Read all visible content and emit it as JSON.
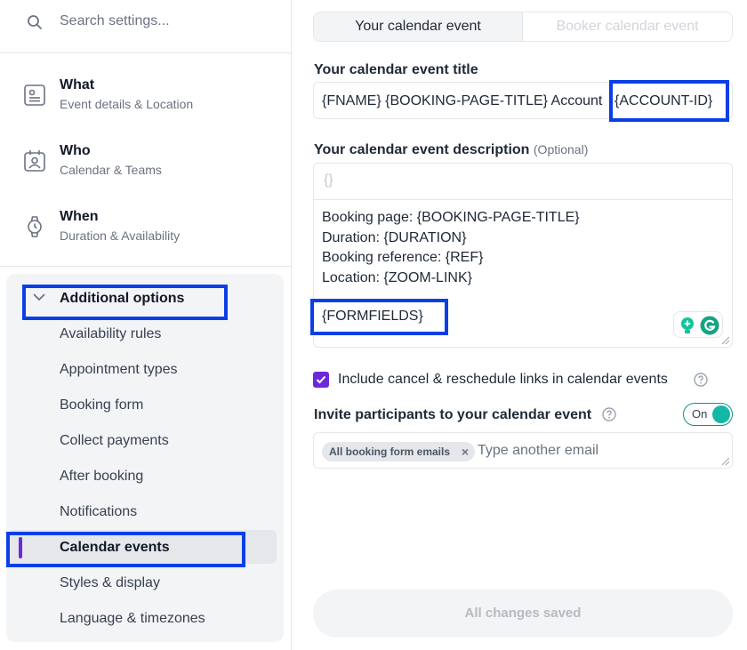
{
  "search": {
    "placeholder": "Search settings..."
  },
  "nav": [
    {
      "title": "What",
      "subtitle": "Event details & Location",
      "icon": "event-details-icon"
    },
    {
      "title": "Who",
      "subtitle": "Calendar & Teams",
      "icon": "calendar-team-icon"
    },
    {
      "title": "When",
      "subtitle": "Duration & Availability",
      "icon": "watch-icon"
    }
  ],
  "additional": {
    "title": "Additional options",
    "items": [
      {
        "label": "Availability rules"
      },
      {
        "label": "Appointment types"
      },
      {
        "label": "Booking form"
      },
      {
        "label": "Collect payments"
      },
      {
        "label": "After booking"
      },
      {
        "label": "Notifications"
      },
      {
        "label": "Calendar events",
        "active": true
      },
      {
        "label": "Styles & display"
      },
      {
        "label": "Language & timezones"
      }
    ]
  },
  "tabs": {
    "active": "Your calendar event",
    "inactive": "Booker calendar event"
  },
  "title_field": {
    "label": "Your calendar event title",
    "value": "{FNAME} {BOOKING-PAGE-TITLE} Account",
    "value_tail": "{ACCOUNT-ID}"
  },
  "description": {
    "label": "Your calendar event description",
    "optional": "(Optional)",
    "insert_symbol": "{}",
    "lines": [
      "Booking page: {BOOKING-PAGE-TITLE}",
      "Duration: {DURATION}",
      "Booking reference: {REF}",
      "Location: {ZOOM-LINK}",
      "{FORMFIELDS}"
    ]
  },
  "include_links": {
    "label": "Include cancel & reschedule links in calendar events",
    "checked": true
  },
  "invite": {
    "label": "Invite participants to your calendar event",
    "toggle": "On"
  },
  "emails": {
    "chip": "All booking form emails",
    "chip_remove": "×",
    "placeholder": "Type another email"
  },
  "save": {
    "label": "All changes saved"
  },
  "colors": {
    "accent": "#6d28d9",
    "toggle": "#14b8a6",
    "highlight": "#0a3fe6"
  }
}
